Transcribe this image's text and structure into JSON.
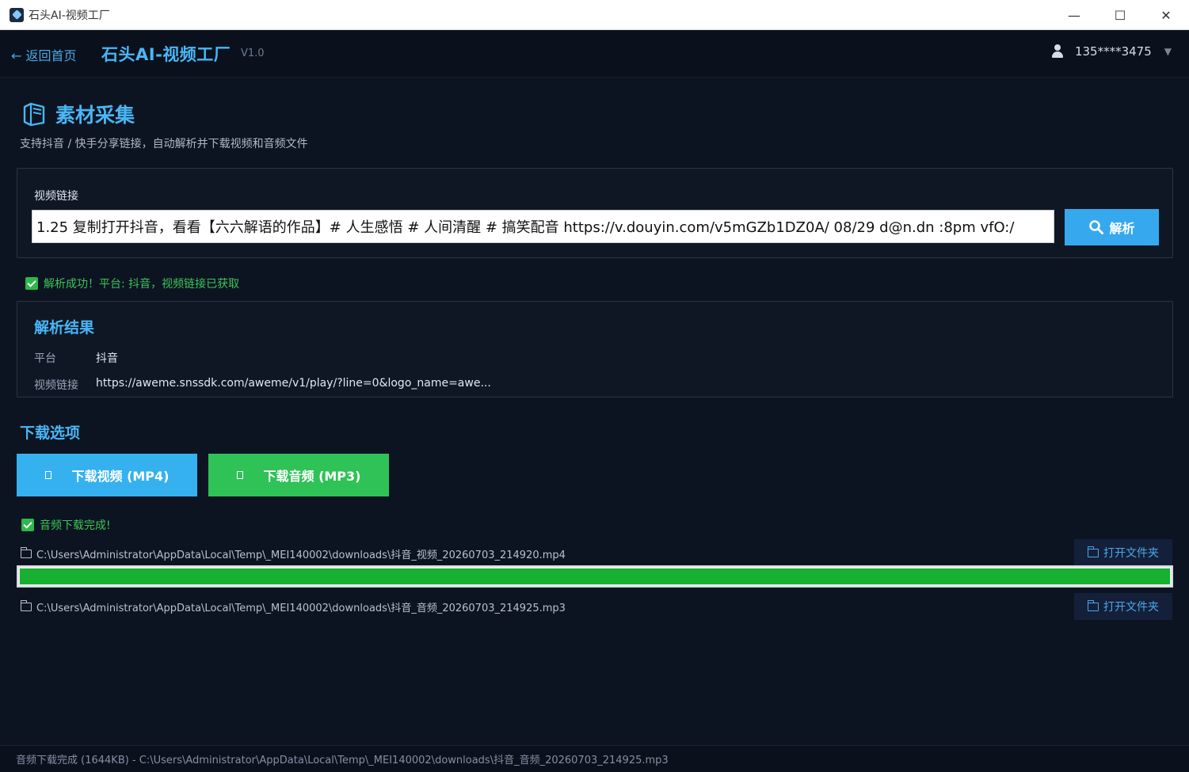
{
  "window": {
    "title": "石头AI-视频工厂",
    "minimize": "—",
    "maximize": "☐",
    "close": "✕"
  },
  "header": {
    "back_label": "← 返回首页",
    "brand": "石头AI-视频工厂",
    "version": "V1.0",
    "user": "135****3475",
    "user_menu_caret": "▼"
  },
  "collect": {
    "title": "素材采集",
    "subtitle": "支持抖音 / 快手分享链接，自动解析并下载视频和音频文件",
    "url_label": "视频链接",
    "url_value": "1.25 复制打开抖音，看看【六六解语的作品】# 人生感悟 # 人间清醒 # 搞笑配音  https://v.douyin.com/v5mGZb1DZ0A/ 08/29 d@n.dn :8pm vfO:/",
    "parse_label": "解析",
    "parse_status": "解析成功！平台: 抖音，视频链接已获取"
  },
  "result": {
    "title": "解析结果",
    "platform_key": "平台",
    "platform_value": "抖音",
    "link_key": "视频链接",
    "link_value": "https://aweme.snssdk.com/aweme/v1/play/?line=0&logo_name=awe..."
  },
  "download": {
    "title": "下载选项",
    "video_label": "下载视频 (MP4)",
    "audio_label": "下载音频 (MP3)",
    "status": "音频下载完成!",
    "progress": 1.0,
    "files": [
      {
        "path": "C:\\Users\\Administrator\\AppData\\Local\\Temp\\_MEI140002\\downloads\\抖音_视频_20260703_214920.mp4",
        "open_label": "打开文件夹"
      },
      {
        "path": "C:\\Users\\Administrator\\AppData\\Local\\Temp\\_MEI140002\\downloads\\抖音_音频_20260703_214925.mp3",
        "open_label": "打开文件夹"
      }
    ]
  },
  "statusbar": {
    "text": "音频下载完成 (1644KB) - C:\\Users\\Administrator\\AppData\\Local\\Temp\\_MEI140002\\downloads\\抖音_音频_20260703_214925.mp3"
  },
  "colors": {
    "accent": "#49b6f5",
    "success": "#2fb64d",
    "progress": "#17b030"
  }
}
